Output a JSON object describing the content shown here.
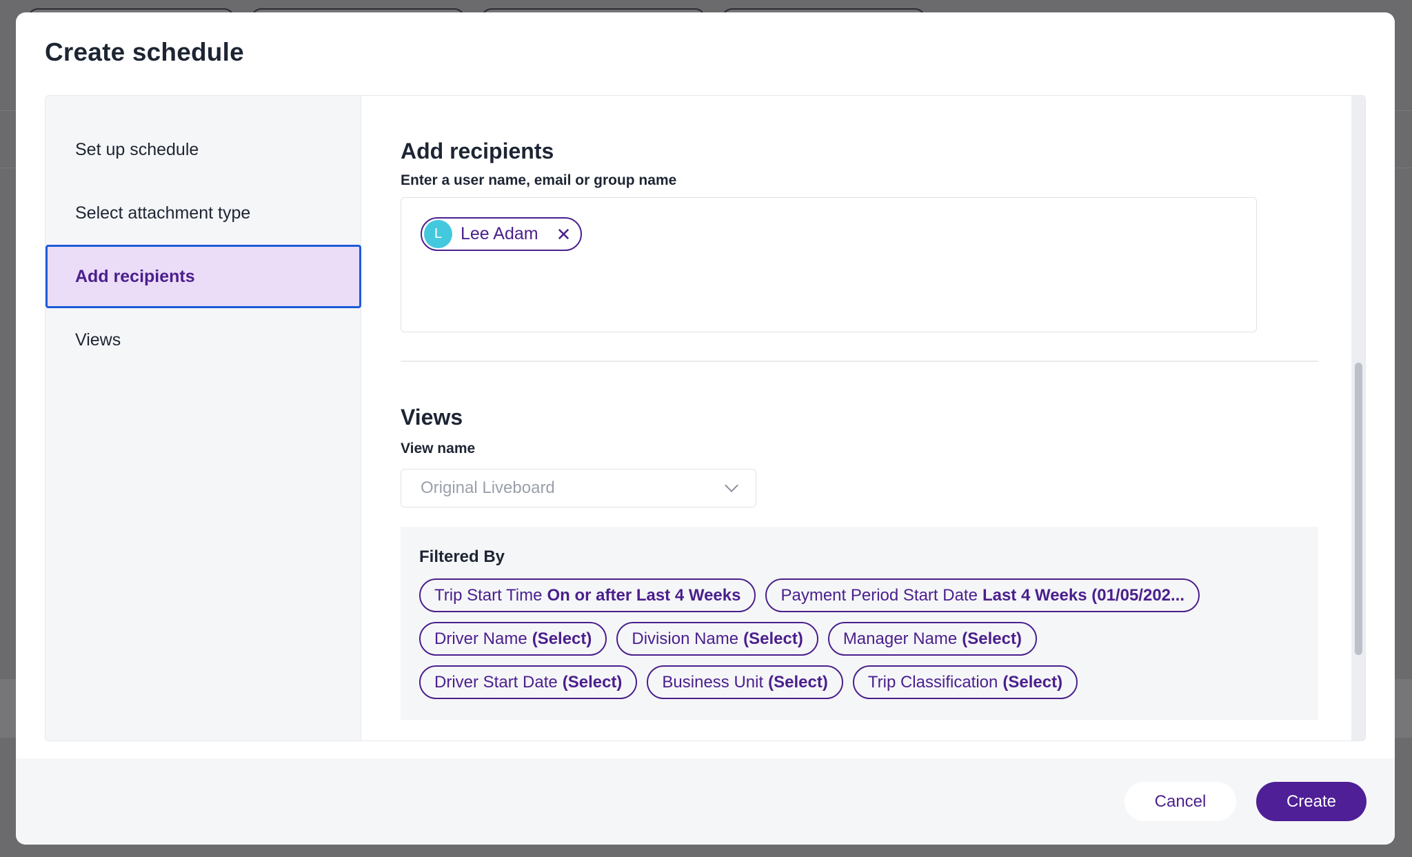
{
  "modal": {
    "title": "Create schedule"
  },
  "steps": [
    {
      "label": "Set up schedule",
      "active": false
    },
    {
      "label": "Select attachment type",
      "active": false
    },
    {
      "label": "Add recipients",
      "active": true
    },
    {
      "label": "Views",
      "active": false
    }
  ],
  "recipients": {
    "title": "Add recipients",
    "field_label": "Enter a user name, email or group name",
    "chips": [
      {
        "initial": "L",
        "name": "Lee Adam",
        "avatar_color": "#44c8dd"
      }
    ]
  },
  "views": {
    "title": "Views",
    "view_name_label": "View name",
    "view_name_value": "Original Liveboard",
    "filtered_by_title": "Filtered By",
    "filters": [
      {
        "name": "Trip Start Time",
        "value": "On or after Last 4 Weeks"
      },
      {
        "name": "Payment Period Start Date",
        "value": "Last 4 Weeks (01/05/202..."
      },
      {
        "name": "Driver Name",
        "value": "(Select)"
      },
      {
        "name": "Division Name",
        "value": "(Select)"
      },
      {
        "name": "Manager Name",
        "value": "(Select)"
      },
      {
        "name": "Driver Start Date",
        "value": "(Select)"
      },
      {
        "name": "Business Unit",
        "value": "(Select)"
      },
      {
        "name": "Trip Classification",
        "value": "(Select)"
      }
    ]
  },
  "footer": {
    "cancel_label": "Cancel",
    "create_label": "Create"
  },
  "colors": {
    "accent": "#4a1f8c",
    "primary_button": "#4e1f96",
    "active_step_bg": "#ebdcf7",
    "focus_border": "#1d5bd6"
  }
}
